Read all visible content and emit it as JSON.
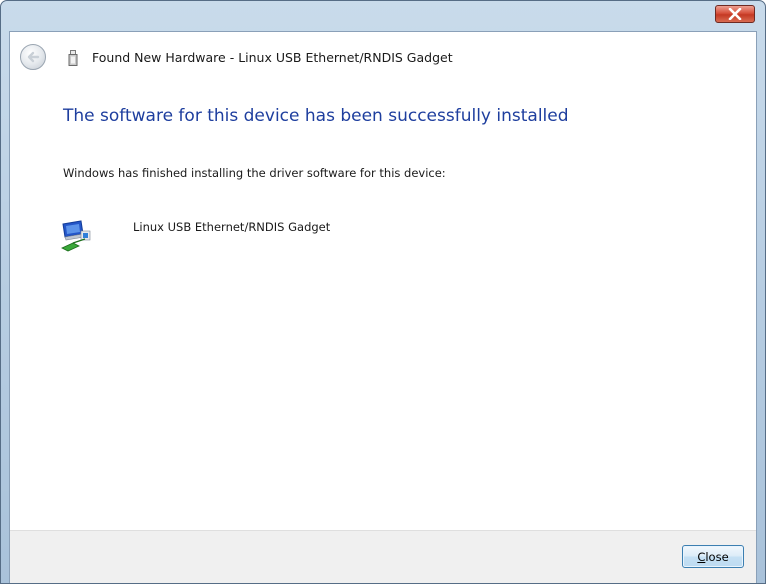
{
  "window": {
    "title": "Found New Hardware - Linux USB Ethernet/RNDIS Gadget",
    "close_icon": "close-icon"
  },
  "content": {
    "heading": "The software for this device has been successfully installed",
    "description": "Windows has finished installing the driver software for this device:",
    "device": {
      "icon": "network-adapter-icon",
      "name": "Linux USB Ethernet/RNDIS Gadget"
    }
  },
  "footer": {
    "close_mnemonic": "C",
    "close_rest": "lose"
  },
  "colors": {
    "heading": "#1e3e9e",
    "title_close_button": "#c43923",
    "footer_bg": "#f0f0f0",
    "button_border": "#3c7fb1"
  }
}
